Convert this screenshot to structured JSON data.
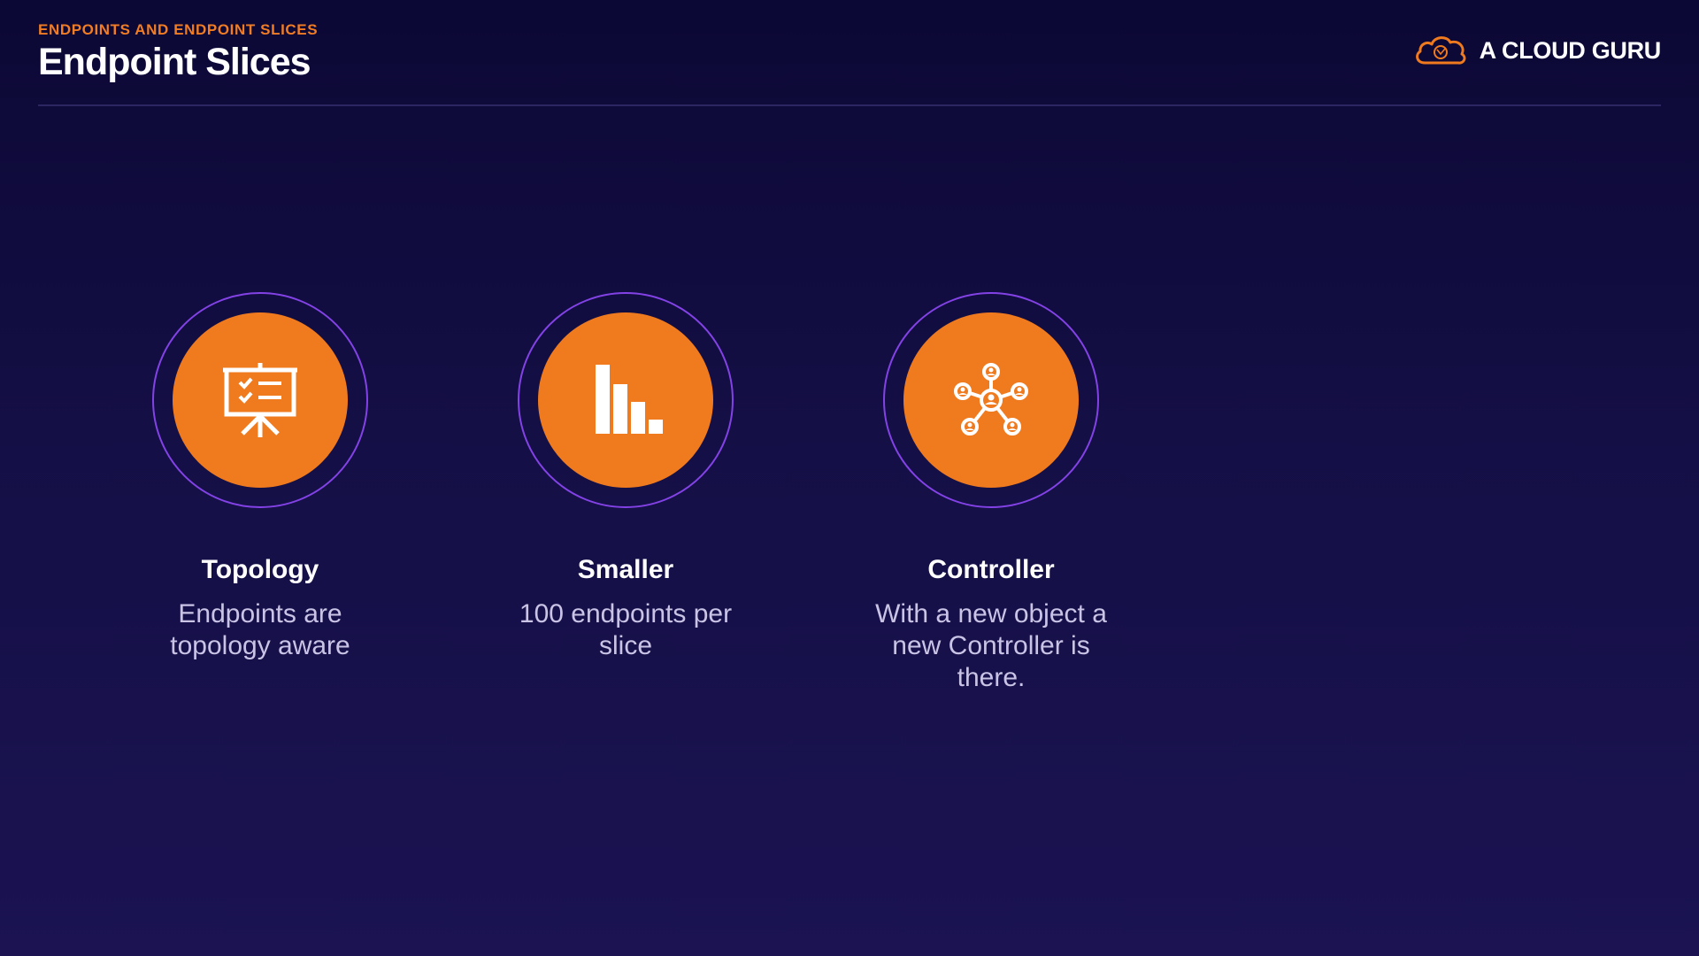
{
  "header": {
    "eyebrow": "ENDPOINTS AND ENDPOINT SLICES",
    "title": "Endpoint Slices"
  },
  "brand": {
    "name": "A CLOUD GURU",
    "icon": "cloud-logo-icon"
  },
  "features": [
    {
      "icon": "presentation-board-icon",
      "title": "Topology",
      "description": "Endpoints are topology aware"
    },
    {
      "icon": "bar-chart-descending-icon",
      "title": "Smaller",
      "description": "100 endpoints per slice"
    },
    {
      "icon": "network-hub-icon",
      "title": "Controller",
      "description": "With a new object a new Controller is there."
    }
  ],
  "colors": {
    "accent": "#f07b1f",
    "ring": "#8342e6",
    "background": "#140f45",
    "muted_text": "#c9c4e6"
  }
}
